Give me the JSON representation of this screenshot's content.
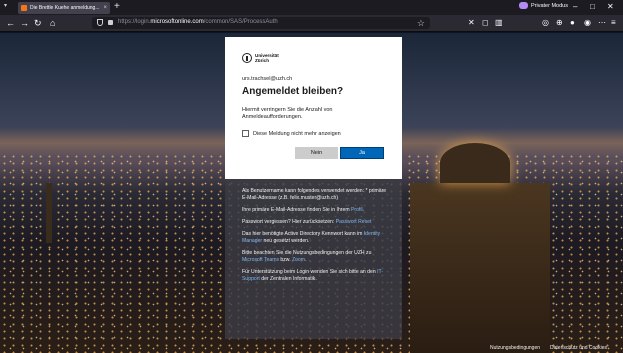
{
  "browser": {
    "tab_title": "Die Brettle Kuehe anmeldung...",
    "tab_close": "×",
    "new_tab": "+",
    "private_label": "Privater Modus",
    "url_prefix": "https://login.",
    "url_host": "microsoftonline.com",
    "url_path": "/common/SAS/ProcessAuth",
    "colors": {
      "chrome_bg": "#1c1b22",
      "navbar_bg": "#2b2a33",
      "private_accent": "#b38bf5"
    }
  },
  "card": {
    "logo_line1": "Universität",
    "logo_line2": "Zürich",
    "email": "urs.trachsel@uzh.ch",
    "title": "Angemeldet bleiben?",
    "description": "Hiermit verringern Sie die Anzahl von Anmeldeaufforderungen.",
    "checkbox_label": "Diese Meldung nicht mehr anzeigen",
    "no_label": "Nein",
    "yes_label": "Ja",
    "colors": {
      "primary": "#0067b8",
      "secondary": "#cccccc"
    }
  },
  "info": {
    "p1": "Als Benutzername kann folgendes verwendet werden: * primäre E-Mail-Adresse (z.B. felix.muster@uzh.ch)",
    "p2_text": "Ihre primäre E-Mail-Adresse finden Sie in Ihrem ",
    "p2_link": "Profil",
    "p2_end": ".",
    "p3_text": "Passwort vergessen? Hier zurücksetzen: ",
    "p3_link": "Passwort Reset",
    "p4_text": "Das hier benötigte Active Directory Kennwort kann im ",
    "p4_link": "Identity Manager",
    "p4_end": " neu gesetzt werden.",
    "p5_text": "Bitte beachten Sie die Nutzungsbedingungen der UZH zu ",
    "p5_link1": "Microsoft Teams",
    "p5_mid": " bzw. ",
    "p5_link2": "Zoom",
    "p5_end": ".",
    "p6_text": "Für Unterstützung beim Login wenden Sie sich bitte an den ",
    "p6_link": "IT-Support",
    "p6_end": " der Zentralen Informatik."
  },
  "footer": {
    "terms": "Nutzungsbedingungen",
    "privacy": "Datenschutz und Cookies"
  }
}
